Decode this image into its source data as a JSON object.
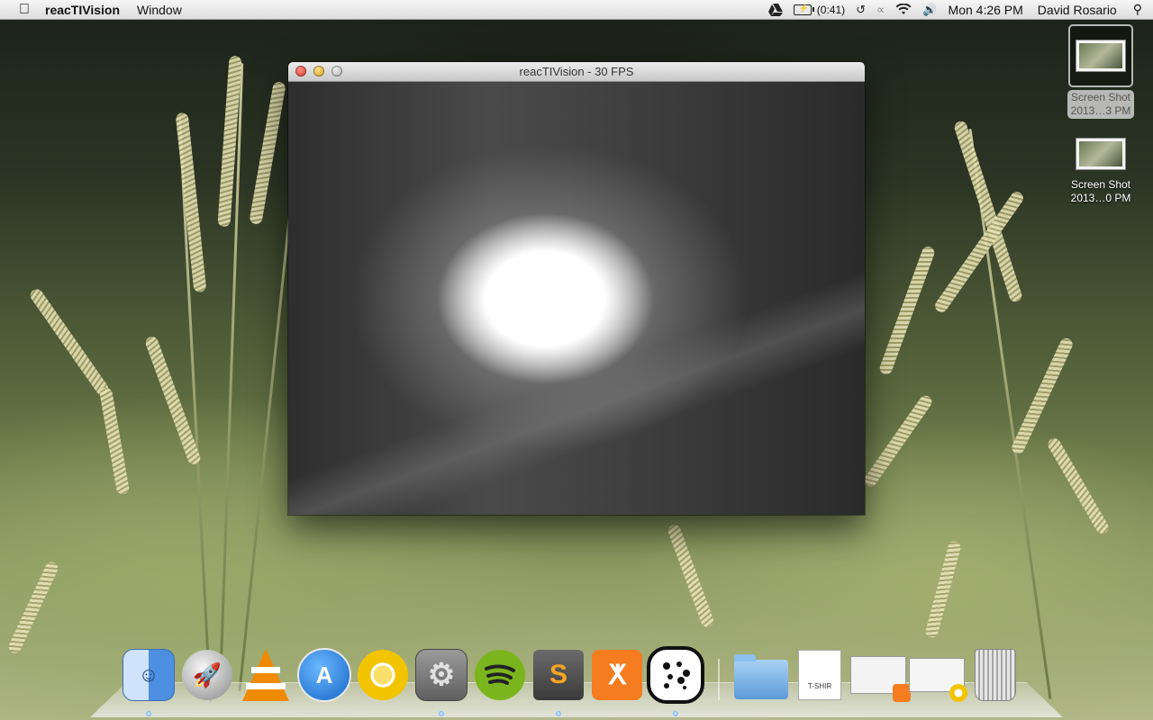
{
  "menubar": {
    "app_name": "reacTIVision",
    "menus": [
      "Window"
    ],
    "battery_time": "(0:41)",
    "clock": "Mon 4:26 PM",
    "user": "David Rosario"
  },
  "window": {
    "title": "reacTIVision - 30 FPS"
  },
  "desktop_icons": [
    {
      "name_line1": "Screen Shot",
      "name_line2": "2013…3 PM",
      "selected": true
    },
    {
      "name_line1": "Screen Shot",
      "name_line2": "2013…0 PM",
      "selected": false
    }
  ],
  "dock": {
    "apps": [
      {
        "name": "Finder",
        "icon": "finder-icon",
        "color": "#5b9be8"
      },
      {
        "name": "Launchpad",
        "icon": "rocket-icon",
        "color": "#9a9a9a"
      },
      {
        "name": "VLC",
        "icon": "traffic-cone-icon",
        "color": "#f08a00"
      },
      {
        "name": "App Store",
        "icon": "app-store-icon",
        "color": "#2b7fd9"
      },
      {
        "name": "Chrome Canary",
        "icon": "chrome-icon",
        "color": "#f2c400"
      },
      {
        "name": "System Preferences",
        "icon": "gear-icon",
        "color": "#7d7d7d"
      },
      {
        "name": "Spotify",
        "icon": "spotify-icon",
        "color": "#7ab51d"
      },
      {
        "name": "Sublime Text",
        "icon": "sublime-icon",
        "color": "#555555"
      },
      {
        "name": "XAMPP",
        "icon": "xampp-icon",
        "color": "#f57c1f"
      },
      {
        "name": "reacTIVision",
        "icon": "fiducial-icon",
        "color": "#111111"
      }
    ],
    "docs": [
      {
        "name": "Folder",
        "icon": "folder-icon",
        "color": "#7fb6e8"
      },
      {
        "name": "T-shirt doc",
        "icon": "document-icon",
        "color": "#ffffff",
        "text": "T-SHIR"
      },
      {
        "name": "XAMPP Controls",
        "icon": "xampp-window-icon",
        "color": "#f3f3f3"
      },
      {
        "name": "Preview window",
        "icon": "preview-window-icon",
        "color": "#f5f5f5"
      },
      {
        "name": "Trash",
        "icon": "trash-icon",
        "color": "#c9c9c9"
      }
    ]
  }
}
